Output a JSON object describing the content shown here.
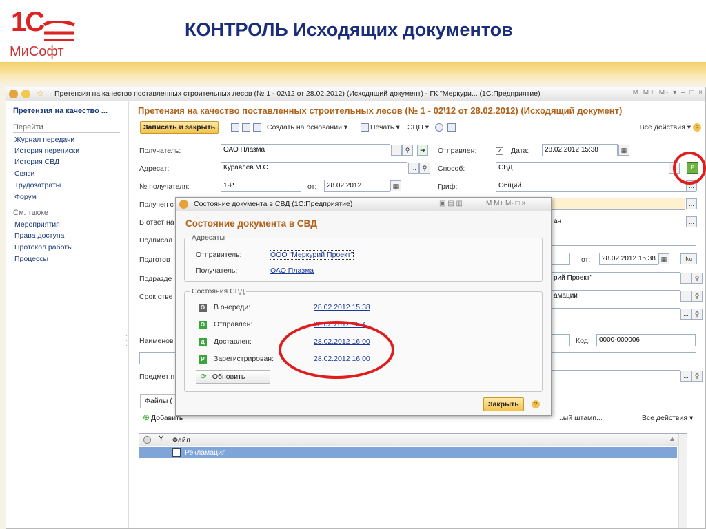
{
  "slide": {
    "title": "КОНТРОЛЬ Исходящих документов",
    "logo_text": "1С",
    "logo_sub": "МиСофт"
  },
  "window": {
    "title": "Претензия на качество поставленных строительных лесов (№ 1 - 02\\12 от 28.02.2012) (Исходящий документ) - ГК \"Меркури... (1С:Предприятие)",
    "controls": "M  M+  M-  ▾  –  □  ×"
  },
  "nav": {
    "doc_title": "Претензия на качество ...",
    "go_label": "Перейти",
    "go_items": [
      "Журнал передачи",
      "История переписки",
      "История СВД",
      "Связи",
      "Трудозатраты",
      "Форум"
    ],
    "see_label": "См. также",
    "see_items": [
      "Мероприятия",
      "Права доступа",
      "Протокол работы",
      "Процессы"
    ]
  },
  "form": {
    "title": "Претензия на качество поставленных строительных лесов (№ 1 - 02\\12 от 28.02.2012) (Исходящий документ)",
    "toolbar": {
      "save": "Записать и закрыть",
      "create_basis": "Создать на основании ▾",
      "print": "Печать ▾",
      "ecp": "ЭЦП ▾",
      "all_actions": "Все действия ▾"
    },
    "recipient_label": "Получатель:",
    "recipient_value": "ОАО Плазма",
    "addressee_label": "Адресат:",
    "addressee_value": "Куравлев М.С.",
    "recipient_no_label": "№ получателя:",
    "recipient_no_value": "1-Р",
    "from_label": "от:",
    "from_value": "28.02.2012",
    "received_label": "Получен с",
    "reply_label": "В ответ на",
    "signed_label": "Подписал",
    "prepared_label": "Подготов",
    "division_label": "Подразде",
    "deadline_label": "Срок отве",
    "name_label": "Наименов",
    "subject_label": "Предмет п",
    "sent_label": "Отправлен:",
    "date_label": "Дата:",
    "sent_date": "28.02.2012 15:38",
    "method_label": "Способ:",
    "method_value": "СВД",
    "grif_label": "Гриф:",
    "grif_value": "Общий",
    "reply_value": "ан",
    "from2_label": "от:",
    "from2_value": "28.02.2012 15:38",
    "no_button": "№",
    "division_value": "рий Проект\"",
    "deadline_value": "амации",
    "code_label": "Код:",
    "code_value": "0000-000006"
  },
  "files": {
    "tab_label": "Файлы (",
    "add": "Добавить",
    "all_actions": "Все действия ▾",
    "toolbar_tail": "...ый штамп...",
    "column": "Файл",
    "rows": [
      "Рекламация"
    ]
  },
  "dialog": {
    "window_title": "Состояние документа в СВД  (1С:Предприятие)",
    "controls": "M  M+  M-  □  ×",
    "title": "Состояние документа в СВД",
    "addressees_group": "Адресаты",
    "sender_label": "Отправитель:",
    "sender_value": "ООО \"Меркурий Проект\"",
    "receiver_label": "Получатель:",
    "receiver_value": "ОАО Плазма",
    "states_group": "Состояния СВД",
    "states": [
      {
        "icon": "О",
        "label": "В очереди:",
        "value": "28.02.2012 15:38",
        "color": "#666666"
      },
      {
        "icon": "О",
        "label": "Отправлен:",
        "value": "28.02.2012 15:4",
        "color": "#3aa53a"
      },
      {
        "icon": "Д",
        "label": "Доставлен:",
        "value": "28.02.2012 16:00",
        "color": "#3aa53a"
      },
      {
        "icon": "Р",
        "label": "Зарегистрирован:",
        "value": "28.02.2012 16:00",
        "color": "#3aa53a"
      }
    ],
    "refresh": "Обновить",
    "close": "Закрыть"
  },
  "colors": {
    "accent": "#b0621a",
    "title_blue": "#1a2d7a",
    "highlight": "#e01d1d"
  }
}
